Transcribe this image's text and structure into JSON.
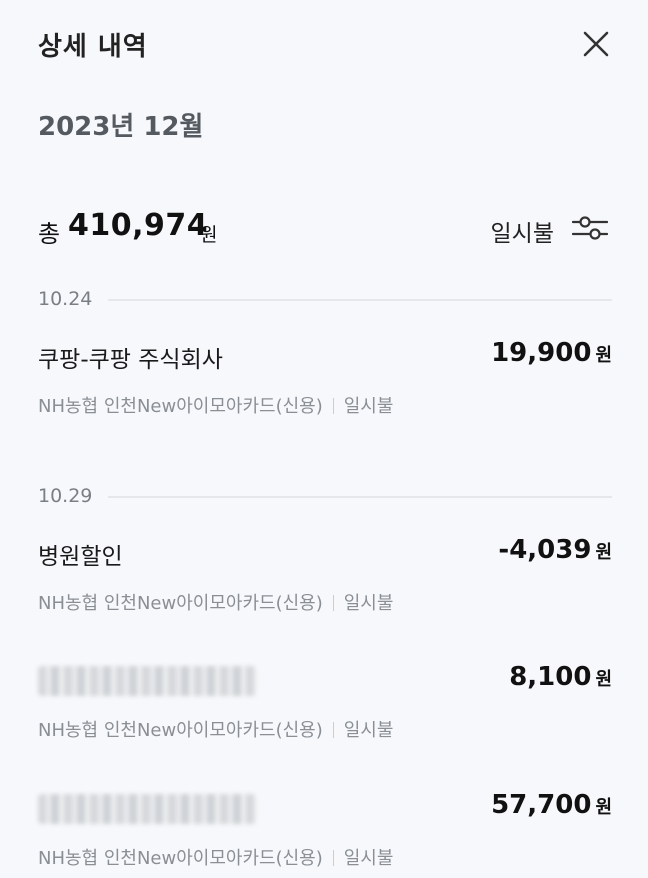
{
  "header": {
    "title": "상세 내역"
  },
  "month": "2023년 12월",
  "summary": {
    "prefix": "총",
    "amount": "410,974",
    "unit": "원",
    "filter_label": "일시불"
  },
  "groups": [
    {
      "date": "10.24",
      "items": [
        {
          "name": "쿠팡-쿠팡 주식회사",
          "amount": "19,900",
          "unit": "원",
          "card": "NH농협 인천New아이모아카드(신용)",
          "type": "일시불"
        }
      ]
    },
    {
      "date": "10.29",
      "items": [
        {
          "name": "병원할인",
          "amount": "-4,039",
          "unit": "원",
          "card": "NH농협 인천New아이모아카드(신용)",
          "type": "일시불"
        },
        {
          "name": "",
          "amount": "8,100",
          "unit": "원",
          "card": "NH농협 인천New아이모아카드(신용)",
          "type": "일시불"
        },
        {
          "name": "",
          "amount": "57,700",
          "unit": "원",
          "card": "NH농협 인천New아이모아카드(신용)",
          "type": "일시불"
        }
      ]
    }
  ]
}
